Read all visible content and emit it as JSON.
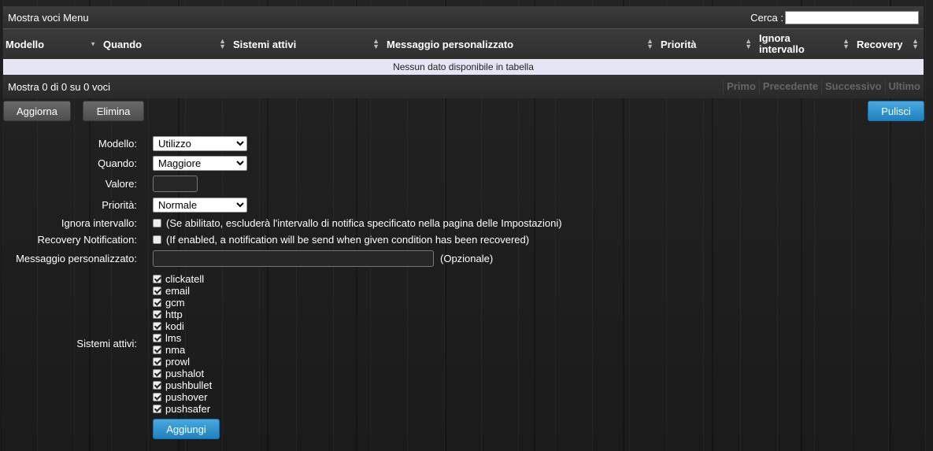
{
  "table": {
    "title": "Mostra voci Menu",
    "search_label": "Cerca :",
    "search_value": "",
    "columns": [
      "Modello",
      "Quando",
      "Sistemi attivi",
      "Messaggio personalizzato",
      "Priorità",
      "Ignora intervallo",
      "Recovery"
    ],
    "empty_message": "Nessun dato disponibile in tabella",
    "info": "Mostra 0 di 0 su 0 voci",
    "pager": {
      "first": "Primo",
      "prev": "Precedente",
      "next": "Successivo",
      "last": "Ultimo"
    }
  },
  "actions": {
    "refresh": "Aggiorna",
    "delete": "Elimina",
    "clear": "Pulisci"
  },
  "form": {
    "model_label": "Modello:",
    "model_value": "Utilizzo",
    "when_label": "Quando:",
    "when_value": "Maggiore",
    "value_label": "Valore:",
    "value_value": "",
    "priority_label": "Priorità:",
    "priority_value": "Normale",
    "ignore_label": "Ignora intervallo:",
    "ignore_text": "(Se abilitato, escluderà l'intervallo di notifica specificato nella pagina delle Impostazioni)",
    "recovery_label": "Recovery Notification:",
    "recovery_text": "(If enabled, a notification will be send when given condition has been recovered)",
    "message_label": "Messaggio personalizzato:",
    "message_value": "",
    "message_hint": "(Opzionale)",
    "systems_label": "Sistemi attivi:",
    "systems": [
      "clickatell",
      "email",
      "gcm",
      "http",
      "kodi",
      "lms",
      "nma",
      "prowl",
      "pushalot",
      "pushbullet",
      "pushover",
      "pushsafer"
    ],
    "add_button": "Aggiungi"
  }
}
